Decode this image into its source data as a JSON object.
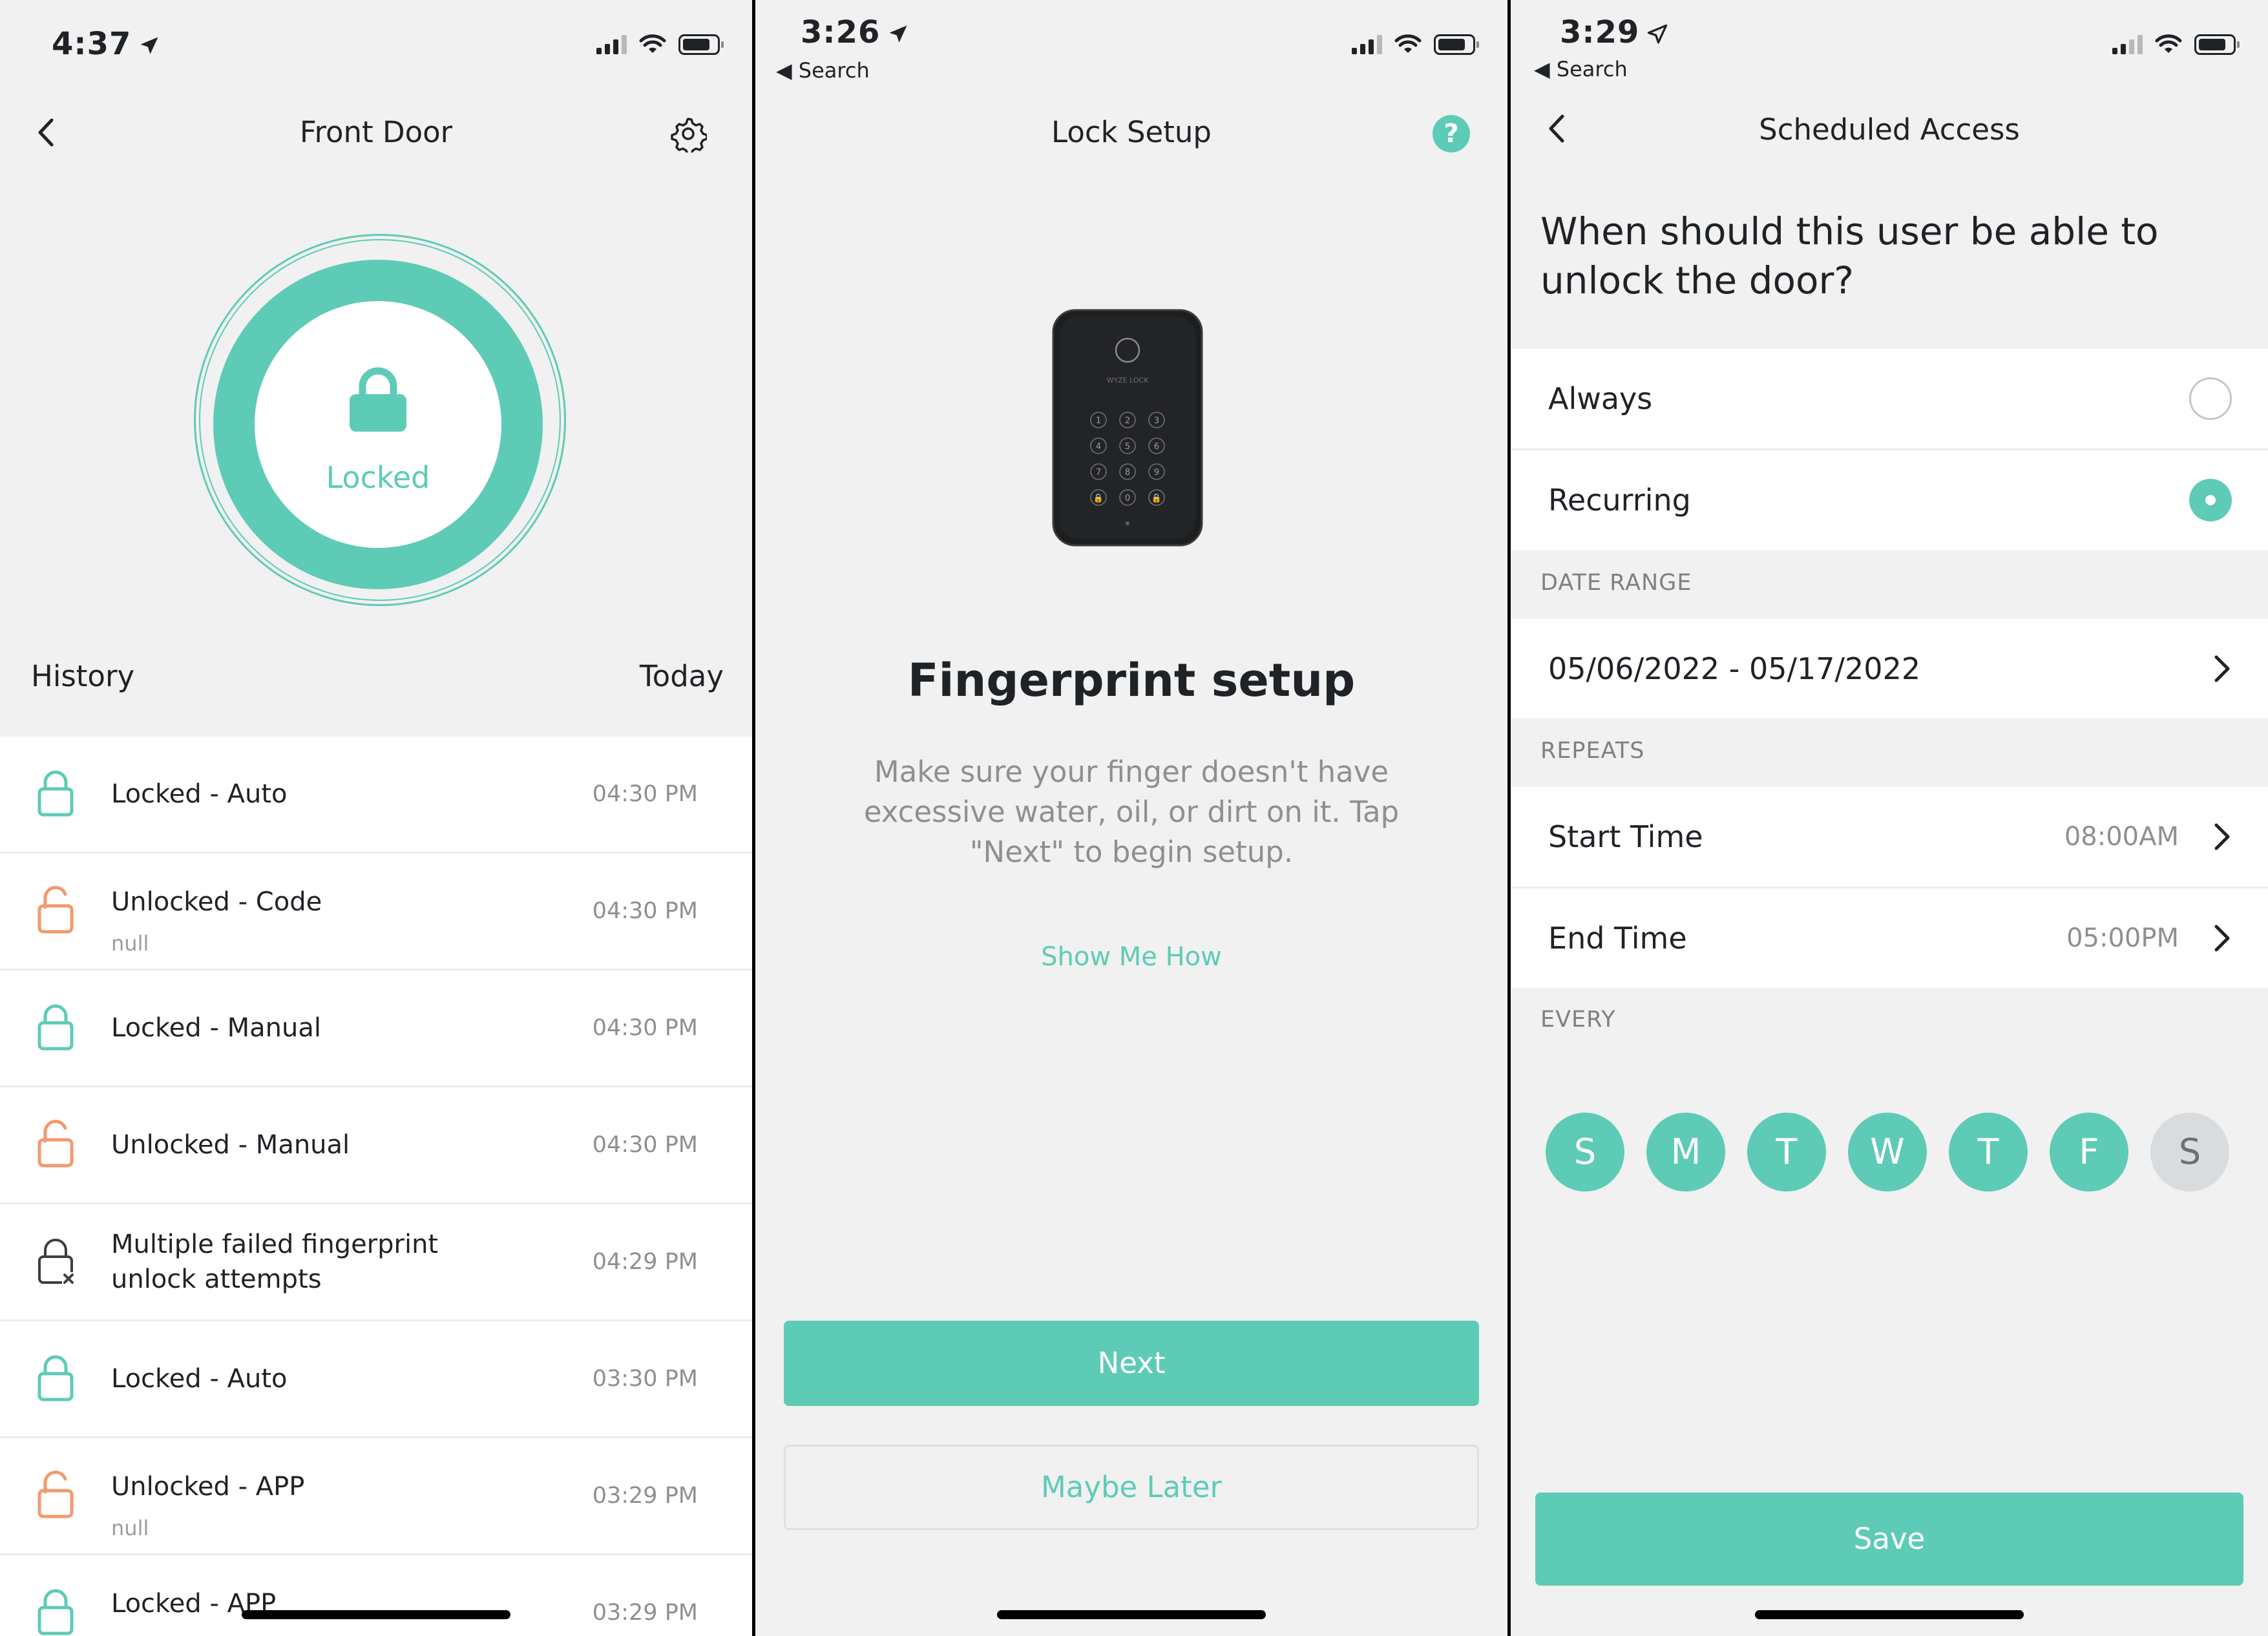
{
  "colors": {
    "accent": "#5ecbb6",
    "unlocked": "#f19a6e",
    "muted": "#8d9093"
  },
  "screen1": {
    "status_time": "4:37",
    "title": "Front Door",
    "lock_state": "Locked",
    "history_label": "History",
    "history_period": "Today",
    "history": [
      {
        "label": "Locked - Auto",
        "sub": "",
        "time": "04:30 PM",
        "icon": "lock-closed-icon"
      },
      {
        "label": "Unlocked - Code",
        "sub": "null",
        "time": "04:30 PM",
        "icon": "lock-open-icon"
      },
      {
        "label": "Locked - Manual",
        "sub": "",
        "time": "04:30 PM",
        "icon": "lock-closed-icon"
      },
      {
        "label": "Unlocked - Manual",
        "sub": "",
        "time": "04:30 PM",
        "icon": "lock-open-icon"
      },
      {
        "label": "Multiple failed fingerprint unlock attempts",
        "sub": "",
        "time": "04:29 PM",
        "icon": "lock-failed-icon"
      },
      {
        "label": "Locked - Auto",
        "sub": "",
        "time": "03:30 PM",
        "icon": "lock-closed-icon"
      },
      {
        "label": "Unlocked - APP",
        "sub": "null",
        "time": "03:29 PM",
        "icon": "lock-open-icon"
      },
      {
        "label": "Locked - APP",
        "sub": "null",
        "time": "03:29 PM",
        "icon": "lock-closed-icon"
      }
    ]
  },
  "screen2": {
    "status_time": "3:26",
    "back_app": "◀ Search",
    "title": "Lock Setup",
    "help": "?",
    "heading": "Fingerprint setup",
    "body": "Make sure your finger doesn't have excessive water, oil, or dirt on it. Tap \"Next\" to begin setup.",
    "show_me_how": "Show Me How",
    "next_label": "Next",
    "later_label": "Maybe Later",
    "keypad": [
      "1",
      "2",
      "3",
      "4",
      "5",
      "6",
      "7",
      "8",
      "9",
      "🔒",
      "0",
      "🔒"
    ],
    "keypad_brand": "WYZE LOCK"
  },
  "screen3": {
    "status_time": "3:29",
    "back_app": "◀ Search",
    "title": "Scheduled Access",
    "question": "When should this user be able to unlock the door?",
    "options": [
      {
        "label": "Always",
        "selected": false
      },
      {
        "label": "Recurring",
        "selected": true
      }
    ],
    "date_range_caption": "DATE RANGE",
    "date_range": "05/06/2022 - 05/17/2022",
    "repeats_caption": "REPEATS",
    "start_time_label": "Start Time",
    "start_time_value": "08:00AM",
    "end_time_label": "End Time",
    "end_time_value": "05:00PM",
    "every_caption": "EVERY",
    "days": [
      {
        "letter": "S",
        "active": true
      },
      {
        "letter": "M",
        "active": true
      },
      {
        "letter": "T",
        "active": true
      },
      {
        "letter": "W",
        "active": true
      },
      {
        "letter": "T",
        "active": true
      },
      {
        "letter": "F",
        "active": true
      },
      {
        "letter": "S",
        "active": false
      }
    ],
    "save_label": "Save"
  }
}
